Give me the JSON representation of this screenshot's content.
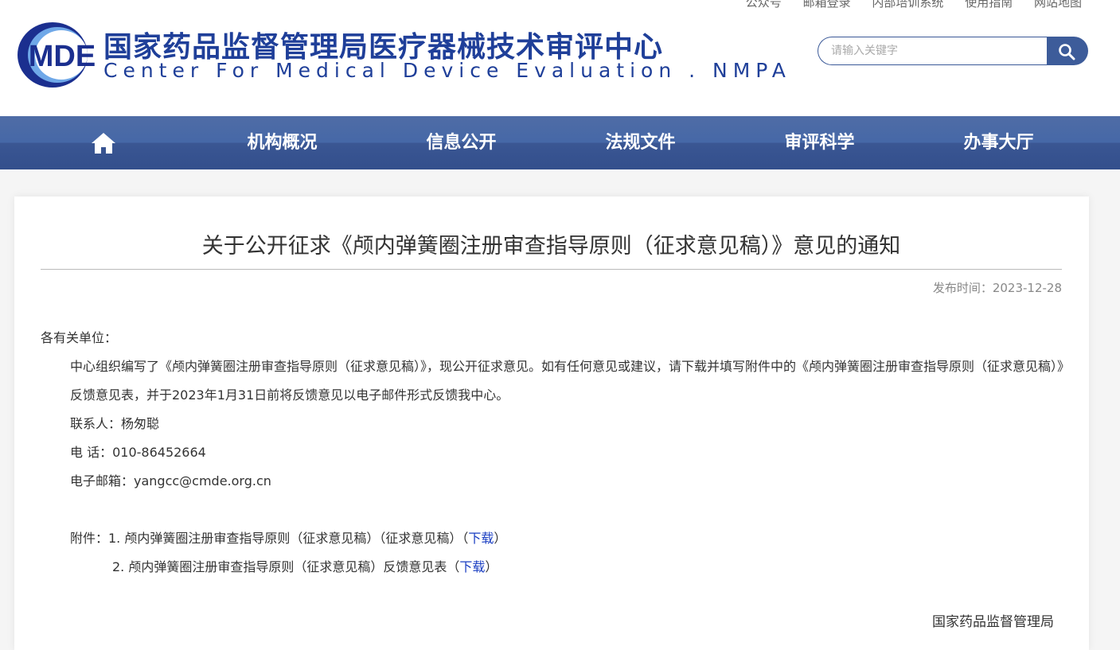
{
  "header": {
    "top_links": [
      "公众号",
      "邮箱登录",
      "内部培训系统",
      "使用指南",
      "网站地图"
    ],
    "logo_text": "MDE",
    "site_title": "国家药品监督管理局医疗器械技术审评中心",
    "site_subtitle": "Center For Medical Device Evaluation . NMPA",
    "search_placeholder": "请输入关键字"
  },
  "nav": {
    "items": [
      "机构概况",
      "信息公开",
      "法规文件",
      "审评科学",
      "办事大厅"
    ]
  },
  "article": {
    "title": "关于公开征求《颅内弹簧圈注册审查指导原则（征求意见稿）》意见的通知",
    "publish_date": "发布时间：2023-12-28",
    "salutation": "各有关单位：",
    "paragraph": "中心组织编写了《颅内弹簧圈注册审查指导原则（征求意见稿）》，现公开征求意见。如有任何意见或建议，请下载并填写附件中的《颅内弹簧圈注册审查指导原则（征求意见稿）》反馈意见表，并于2023年1月31日前将反馈意见以电子邮件形式反馈我中心。",
    "contact": "联系人：杨匆聪",
    "phone": "电 话：010-86452664",
    "email": "电子邮箱：yangcc@cmde.org.cn",
    "attachment_1_prefix": "附件：1. 颅内弹簧圈注册审查指导原则（征求意见稿）（征求意见稿）（",
    "attachment_2_prefix": "2. 颅内弹簧圈注册审查指导原则（征求意见稿）反馈意见表（",
    "download_label": "下载",
    "close_paren": "）",
    "organization": "国家药品监督管理局"
  },
  "colors": {
    "nav_blue": "#3d5c9a",
    "brand_blue": "#1f3f99",
    "link_blue": "#1a3ec2"
  }
}
